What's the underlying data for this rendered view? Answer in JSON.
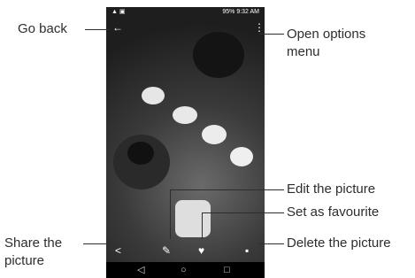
{
  "callouts": {
    "go_back": "Go back",
    "open_options_menu": "Open options\nmenu",
    "edit_picture": "Edit the picture",
    "set_favourite": "Set as favourite",
    "share_picture": "Share the\npicture",
    "delete_picture": "Delete the picture"
  },
  "status_bar": {
    "battery": "95%",
    "time": "9:32 AM"
  },
  "icons": {
    "back": "arrow-left-icon",
    "menu": "more-vert-icon",
    "share": "share-icon",
    "edit": "pencil-icon",
    "favourite": "heart-icon",
    "delete": "trash-icon",
    "nav_back": "nav-back-icon",
    "nav_home": "nav-home-icon",
    "nav_recent": "nav-recent-icon"
  }
}
